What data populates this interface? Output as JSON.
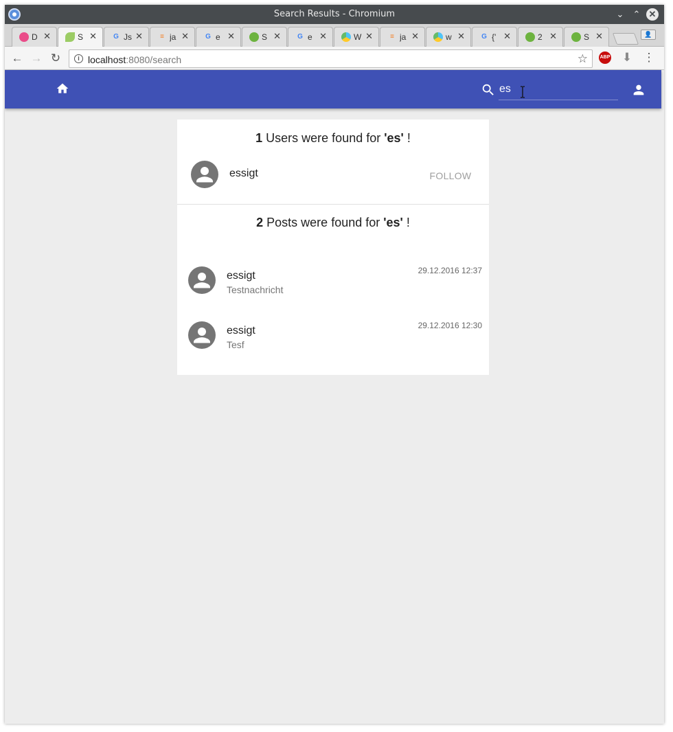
{
  "window": {
    "title": "Search Results - Chromium",
    "controls": {
      "minimize": "⌄",
      "maximize": "⌃",
      "close": "✕"
    }
  },
  "tabs": [
    {
      "label": "D",
      "icon": "dribbble-icon",
      "active": false
    },
    {
      "label": "S",
      "icon": "spring-leaf-icon",
      "active": true
    },
    {
      "label": "Js",
      "icon": "google-icon",
      "active": false
    },
    {
      "label": "ja",
      "icon": "stackoverflow-icon",
      "active": false
    },
    {
      "label": "e",
      "icon": "google-icon",
      "active": false
    },
    {
      "label": "S",
      "icon": "spring-icon",
      "active": false
    },
    {
      "label": "e",
      "icon": "google-icon",
      "active": false
    },
    {
      "label": "W",
      "icon": "multicolor-icon",
      "active": false
    },
    {
      "label": "ja",
      "icon": "stackoverflow-icon",
      "active": false
    },
    {
      "label": "w",
      "icon": "multicolor-icon",
      "active": false
    },
    {
      "label": "{'",
      "icon": "google-icon",
      "active": false
    },
    {
      "label": "2",
      "icon": "spring-icon",
      "active": false
    },
    {
      "label": "S",
      "icon": "spring-icon",
      "active": false
    }
  ],
  "address_bar": {
    "host": "localhost",
    "rest": ":8080/search"
  },
  "extensions": {
    "abp_label": "ABP"
  },
  "app": {
    "search_value": "es",
    "colors": {
      "appbar": "#3f51b5",
      "page_bg": "#ededed",
      "avatar": "#757575"
    }
  },
  "users_section": {
    "count": "1",
    "text": " Users were found for ",
    "query": "'es'",
    "suffix": " !",
    "users": [
      {
        "name": "essigt",
        "follow_label": "FOLLOW"
      }
    ]
  },
  "posts_section": {
    "count": "2",
    "text": " Posts were found for ",
    "query": "'es'",
    "suffix": " !",
    "posts": [
      {
        "author": "essigt",
        "text": "Testnachricht",
        "timestamp": "29.12.2016 12:37"
      },
      {
        "author": "essigt",
        "text": "Tesf",
        "timestamp": "29.12.2016 12:30"
      }
    ]
  }
}
